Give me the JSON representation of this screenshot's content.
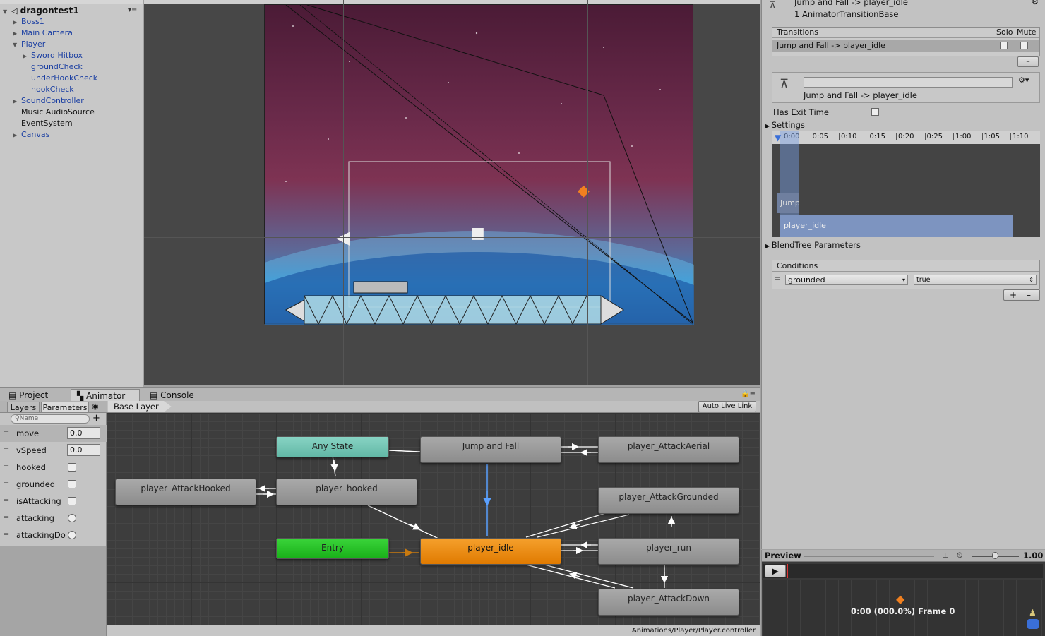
{
  "hierarchy": {
    "scene_name": "dragontest1",
    "items": [
      {
        "label": "Boss1",
        "expandable": true,
        "indent": 1,
        "blue": true
      },
      {
        "label": "Main Camera",
        "expandable": true,
        "indent": 1,
        "blue": true
      },
      {
        "label": "Player",
        "expandable": true,
        "expanded": true,
        "indent": 1,
        "blue": true
      },
      {
        "label": "Sword Hitbox",
        "expandable": true,
        "indent": 2,
        "blue": true
      },
      {
        "label": "groundCheck",
        "expandable": false,
        "indent": 2,
        "blue": true
      },
      {
        "label": "underHookCheck",
        "expandable": false,
        "indent": 2,
        "blue": true
      },
      {
        "label": "hookCheck",
        "expandable": false,
        "indent": 2,
        "blue": true
      },
      {
        "label": "SoundController",
        "expandable": true,
        "indent": 1,
        "blue": true
      },
      {
        "label": "Music AudioSource",
        "expandable": false,
        "indent": 1,
        "blue": false
      },
      {
        "label": "EventSystem",
        "expandable": false,
        "indent": 1,
        "blue": false
      },
      {
        "label": "Canvas",
        "expandable": true,
        "indent": 1,
        "blue": true
      }
    ]
  },
  "bottom_tabs": {
    "project": "Project",
    "animator": "Animator",
    "console": "Console"
  },
  "animator": {
    "layers_tab": "Layers",
    "parameters_tab": "Parameters",
    "search_placeholder": "Name",
    "add_symbol": "+",
    "base_layer": "Base Layer",
    "auto_live_link": "Auto Live Link",
    "controller_path": "Animations/Player/Player.controller",
    "parameters": [
      {
        "name": "move",
        "type": "float",
        "value": "0.0"
      },
      {
        "name": "vSpeed",
        "type": "float",
        "value": "0.0"
      },
      {
        "name": "hooked",
        "type": "bool"
      },
      {
        "name": "grounded",
        "type": "bool"
      },
      {
        "name": "isAttacking",
        "type": "bool"
      },
      {
        "name": "attacking",
        "type": "trigger"
      },
      {
        "name": "attackingDo",
        "type": "trigger"
      }
    ],
    "states": {
      "any_state": "Any State",
      "entry": "Entry",
      "jump_and_fall": "Jump and Fall",
      "attack_aerial": "player_AttackAerial",
      "attack_hooked": "player_AttackHooked",
      "hooked": "player_hooked",
      "attack_grounded": "player_AttackGrounded",
      "idle": "player_idle",
      "run": "player_run",
      "attack_down": "player_AttackDown"
    }
  },
  "inspector": {
    "header_title": "Jump and Fall -> player_idle",
    "header_sub": "1 AnimatorTransitionBase",
    "transitions_label": "Transitions",
    "solo_label": "Solo",
    "mute_label": "Mute",
    "transition_item": "Jump and Fall -> player_idle",
    "remove_symbol": "–",
    "transition_name": "Jump and Fall -> player_idle",
    "has_exit_time_label": "Has Exit Time",
    "settings_label": "Settings",
    "timeline_ticks": [
      "0:00",
      "0:05",
      "0:10",
      "0:15",
      "0:20",
      "0:25",
      "1:00",
      "1:05",
      "1:10"
    ],
    "timeline_source": "Jump",
    "timeline_dest": "player_idle",
    "blendtree_label": "BlendTree Parameters",
    "conditions_label": "Conditions",
    "condition_param": "grounded",
    "condition_value": "true",
    "plus": "+",
    "minus": "–"
  },
  "preview": {
    "label": "Preview",
    "speed": "1.00",
    "frame_text": "0:00 (000.0%) Frame 0"
  }
}
